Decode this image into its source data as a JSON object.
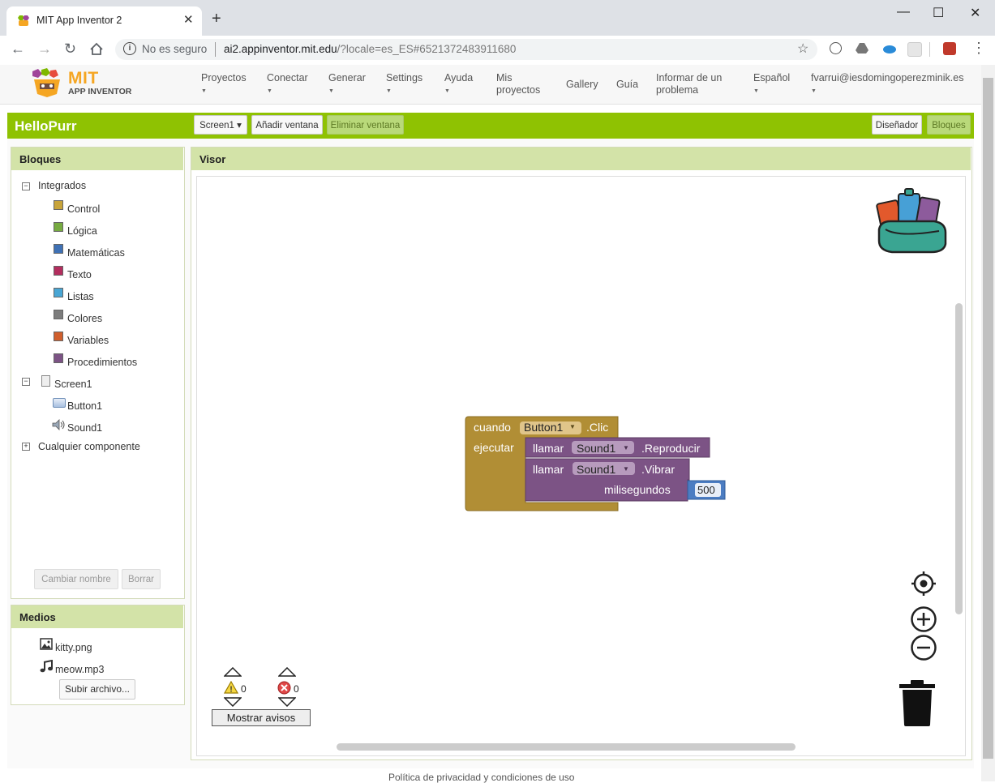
{
  "browser": {
    "tab_title": "MIT App Inventor 2",
    "tab_close": "✕",
    "new_tab": "+",
    "window_controls": {
      "minimize": "—",
      "maximize": "☐",
      "close": "✕"
    },
    "security_label": "No es seguro",
    "url_host": "ai2.appinventor.mit.edu",
    "url_rest": "/?locale=es_ES#6521372483911680"
  },
  "logo": {
    "mit": "MIT",
    "app_inventor": "APP INVENTOR"
  },
  "menu": {
    "proyectos": "Proyectos",
    "conectar": "Conectar",
    "generar": "Generar",
    "settings": "Settings",
    "ayuda": "Ayuda",
    "mis_proyectos_1": "Mis",
    "mis_proyectos_2": "proyectos",
    "gallery": "Gallery",
    "guia": "Guía",
    "informar_1": "Informar de un",
    "informar_2": "problema",
    "idioma": "Español",
    "usuario": "fvarrui@iesdomingoperezminik.es",
    "caret": "▼"
  },
  "project": {
    "name": "HelloPurr",
    "screen_select": "Screen1 ▾",
    "add_screen": "Añadir ventana",
    "remove_screen": "Eliminar ventana",
    "designer": "Diseñador",
    "blocks": "Bloques"
  },
  "bloques": {
    "header": "Bloques",
    "integrados": "Integrados",
    "categories": [
      {
        "label": "Control",
        "color": "#c8a43a"
      },
      {
        "label": "Lógica",
        "color": "#77ab41"
      },
      {
        "label": "Matemáticas",
        "color": "#3f71b5"
      },
      {
        "label": "Texto",
        "color": "#b32d5e"
      },
      {
        "label": "Listas",
        "color": "#49a6d4"
      },
      {
        "label": "Colores",
        "color": "#7d7d7d"
      },
      {
        "label": "Variables",
        "color": "#d05f2d"
      },
      {
        "label": "Procedimientos",
        "color": "#7c5385"
      }
    ],
    "screen": "Screen1",
    "button": "Button1",
    "sound": "Sound1",
    "cualquier": "Cualquier componente",
    "rename": "Cambiar nombre",
    "delete": "Borrar"
  },
  "medios": {
    "header": "Medios",
    "files": [
      "kitty.png",
      "meow.mp3"
    ],
    "upload": "Subir archivo..."
  },
  "visor": {
    "header": "Visor",
    "block": {
      "when": "cuando",
      "component": "Button1",
      "event": ".Clic",
      "do": "ejecutar",
      "call": "llamar",
      "sound": "Sound1",
      "play": ".Reproducir",
      "vibrate": ".Vibrar",
      "ms_label": "milisegundos",
      "ms_value": "500"
    },
    "warnings_count": "0",
    "errors_count": "0",
    "show_warnings": "Mostrar avisos"
  },
  "footer": "Política de privacidad y condiciones de uso"
}
